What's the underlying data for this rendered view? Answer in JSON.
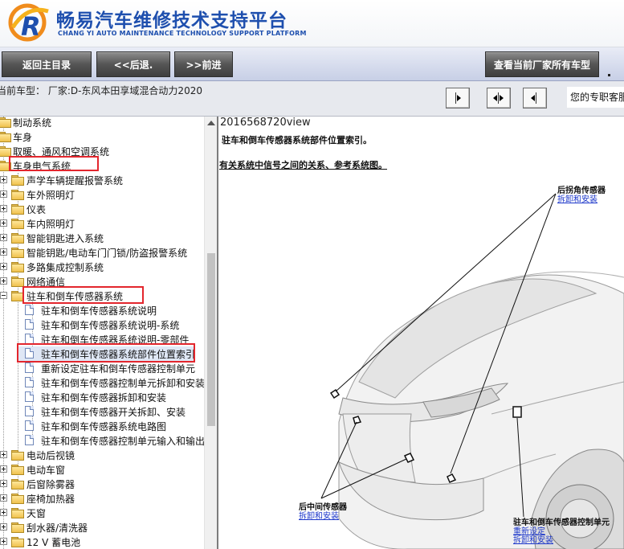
{
  "header": {
    "brand_title": "畅易汽车维修技术支持平台",
    "brand_subtitle": "CHANG YI AUTO MAINTENANCE TECHNOLOGY SUPPORT PLATFORM"
  },
  "toolbar": {
    "home_label": "返回主目录",
    "back_label": "<<后退.",
    "forward_label": ">>前进",
    "all_models_label": "查看当前厂家所有车型"
  },
  "infobar": {
    "model_text": "当前车型：   厂家:D-东风本田享域混合动力2020",
    "expert_text": "您的专职客服"
  },
  "tree": {
    "items": [
      {
        "label": "制动系统"
      },
      {
        "label": "车身"
      },
      {
        "label": "取暖、通风和空调系统"
      },
      {
        "label": "车身电气系统"
      },
      {
        "label": "声学车辆提醒报警系统"
      },
      {
        "label": "车外照明灯"
      },
      {
        "label": "仪表"
      },
      {
        "label": "车内照明灯"
      },
      {
        "label": "智能钥匙进入系统"
      },
      {
        "label": "智能钥匙/电动车门门锁/防盗报警系统"
      },
      {
        "label": "多路集成控制系统"
      },
      {
        "label": "网络通信"
      },
      {
        "label": "驻车和倒车传感器系统"
      },
      {
        "label": "驻车和倒车传感器系统说明"
      },
      {
        "label": "驻车和倒车传感器系统说明-系统"
      },
      {
        "label": "驻车和倒车传感器系统说明-零部件"
      },
      {
        "label": "驻车和倒车传感器系统部件位置索引"
      },
      {
        "label": "重新设定驻车和倒车传感器控制单元"
      },
      {
        "label": "驻车和倒车传感器控制单元拆卸和安装"
      },
      {
        "label": "驻车和倒车传感器拆卸和安装"
      },
      {
        "label": "驻车和倒车传感器开关拆卸、安装"
      },
      {
        "label": "驻车和倒车传感器系统电路图"
      },
      {
        "label": "驻车和倒车传感器控制单元输入和输出"
      },
      {
        "label": "电动后视镜"
      },
      {
        "label": "电动车窗"
      },
      {
        "label": "后窗除雾器"
      },
      {
        "label": "座椅加热器"
      },
      {
        "label": "天窗"
      },
      {
        "label": "刮水器/清洗器"
      },
      {
        "label": "12 V 蓄电池"
      }
    ]
  },
  "content": {
    "doc_id": "2016568720view",
    "title": "驻车和倒车传感器系统部件位置索引。",
    "ref_link": "有关系统中信号之间的关系、参考系统图。",
    "callouts": {
      "rear_corner_sensor": "后拐角传感器",
      "rear_corner_sub": "拆卸和安装",
      "rear_center_sensor": "后中间传感器",
      "rear_center_sub": "拆卸和安装",
      "control_unit": "驻车和倒车传感器控制单元",
      "control_unit_sub1": "重新设定",
      "control_unit_sub2": "拆卸和安装"
    }
  },
  "colors": {
    "brand_blue": "#1e4fae",
    "highlight_red": "#e3262d",
    "link_blue": "#1a35c9"
  }
}
